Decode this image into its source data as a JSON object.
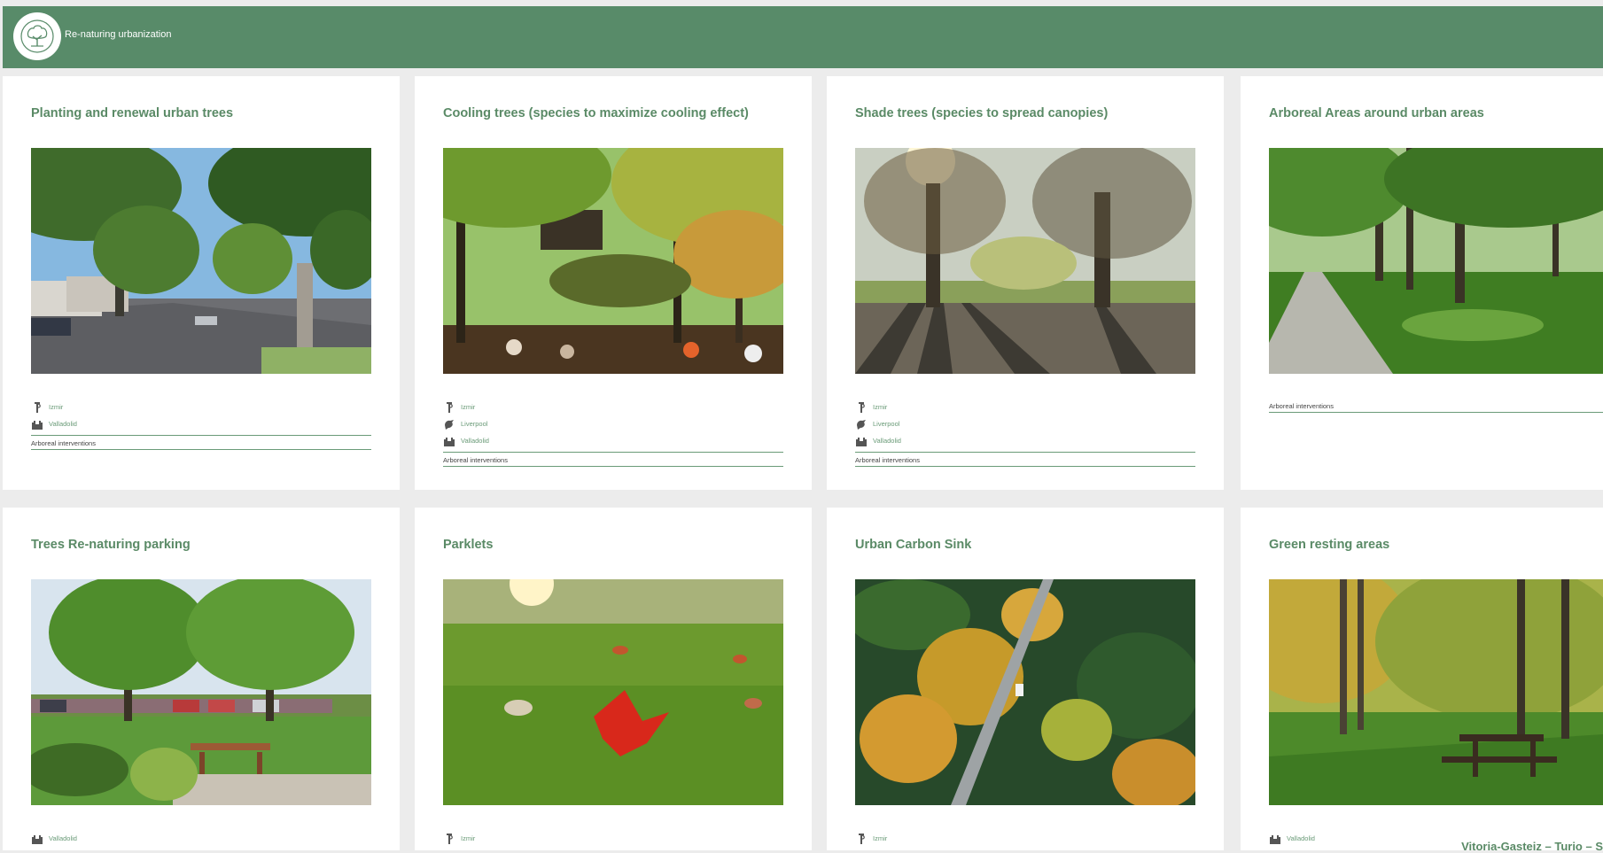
{
  "app": {
    "title": "Re-naturing urbanization",
    "logo_icon": "tree-logo-icon"
  },
  "cards": [
    {
      "title": "Planting and renewal urban trees",
      "cities": [
        {
          "name": "Izmir",
          "icon": "izmir-landmark-icon"
        },
        {
          "name": "Valladolid",
          "icon": "valladolid-landmark-icon"
        }
      ],
      "tag": "Arboreal interventions"
    },
    {
      "title": "Cooling trees (species to maximize cooling effect)",
      "cities": [
        {
          "name": "Izmir",
          "icon": "izmir-landmark-icon"
        },
        {
          "name": "Liverpool",
          "icon": "liverpool-landmark-icon"
        },
        {
          "name": "Valladolid",
          "icon": "valladolid-landmark-icon"
        }
      ],
      "tag": "Arboreal interventions"
    },
    {
      "title": "Shade trees (species to spread canopies)",
      "cities": [
        {
          "name": "Izmir",
          "icon": "izmir-landmark-icon"
        },
        {
          "name": "Liverpool",
          "icon": "liverpool-landmark-icon"
        },
        {
          "name": "Valladolid",
          "icon": "valladolid-landmark-icon"
        }
      ],
      "tag": "Arboreal interventions"
    },
    {
      "title": "Arboreal Areas around urban areas",
      "cities": [],
      "tag": "Arboreal interventions"
    },
    {
      "title": "Trees Re-naturing parking",
      "cities": [
        {
          "name": "Valladolid",
          "icon": "valladolid-landmark-icon"
        }
      ],
      "tag": ""
    },
    {
      "title": "Parklets",
      "cities": [
        {
          "name": "Izmir",
          "icon": "izmir-landmark-icon"
        }
      ],
      "tag": ""
    },
    {
      "title": "Urban Carbon Sink",
      "cities": [
        {
          "name": "Izmir",
          "icon": "izmir-landmark-icon"
        }
      ],
      "tag": ""
    },
    {
      "title": "Green resting areas",
      "cities": [
        {
          "name": "Valladolid",
          "icon": "valladolid-landmark-icon"
        }
      ],
      "tag": ""
    }
  ],
  "footer": {
    "text": "Vitoria-Gasteiz – Turio – S"
  },
  "colors": {
    "header": "#588b69",
    "accent": "#5a8a66",
    "background": "#ececec"
  }
}
